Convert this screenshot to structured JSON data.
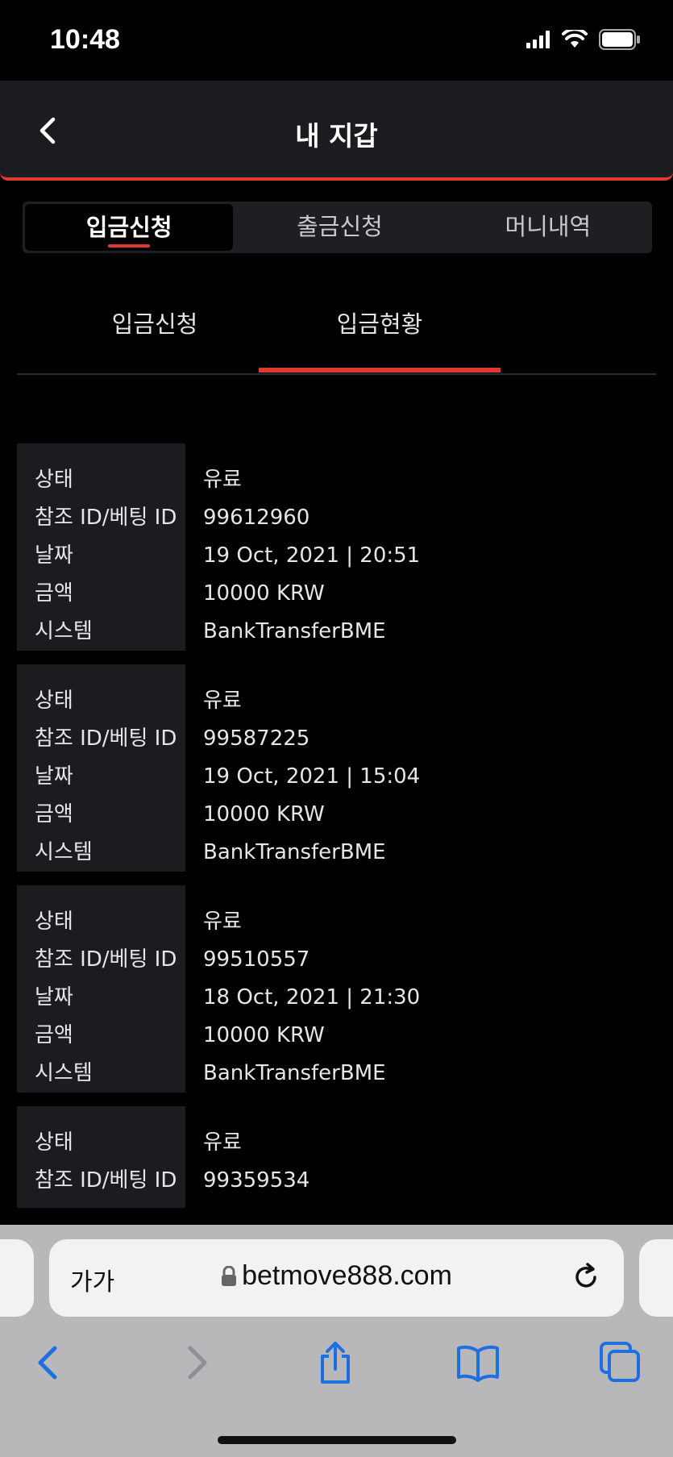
{
  "status_bar": {
    "time": "10:48"
  },
  "header": {
    "title": "내 지갑"
  },
  "tabs": [
    {
      "label": "입금신청",
      "active": true
    },
    {
      "label": "출금신청",
      "active": false
    },
    {
      "label": "머니내역",
      "active": false
    }
  ],
  "subtabs": [
    {
      "label": "입금신청",
      "active": false
    },
    {
      "label": "입금현황",
      "active": true
    }
  ],
  "records": [
    {
      "rows": [
        {
          "label": "상태",
          "value": "유료"
        },
        {
          "label": "참조 ID/베팅 ID",
          "value": "99612960"
        },
        {
          "label": "날짜",
          "value": "19 Oct, 2021 | 20:51"
        },
        {
          "label": "금액",
          "value": "10000 KRW"
        },
        {
          "label": "시스템",
          "value": "BankTransferBME"
        }
      ]
    },
    {
      "rows": [
        {
          "label": "상태",
          "value": "유료"
        },
        {
          "label": "참조 ID/베팅 ID",
          "value": "99587225"
        },
        {
          "label": "날짜",
          "value": "19 Oct, 2021 | 15:04"
        },
        {
          "label": "금액",
          "value": "10000 KRW"
        },
        {
          "label": "시스템",
          "value": "BankTransferBME"
        }
      ]
    },
    {
      "rows": [
        {
          "label": "상태",
          "value": "유료"
        },
        {
          "label": "참조 ID/베팅 ID",
          "value": "99510557"
        },
        {
          "label": "날짜",
          "value": "18 Oct, 2021 | 21:30"
        },
        {
          "label": "금액",
          "value": "10000 KRW"
        },
        {
          "label": "시스템",
          "value": "BankTransferBME"
        }
      ]
    },
    {
      "rows": [
        {
          "label": "상태",
          "value": "유료"
        },
        {
          "label": "참조 ID/베팅 ID",
          "value": "99359534"
        }
      ]
    }
  ],
  "browser": {
    "text_size_label": "가가",
    "url": "betmove888.com"
  },
  "colors": {
    "accent": "#e03a30",
    "ios_blue": "#1f6fe0"
  },
  "icons": [
    "signal-icon",
    "wifi-icon",
    "battery-icon",
    "back-chevron-icon",
    "lock-icon",
    "reload-icon",
    "browser-back-icon",
    "browser-forward-icon",
    "share-icon",
    "bookmarks-icon",
    "tabs-icon"
  ]
}
